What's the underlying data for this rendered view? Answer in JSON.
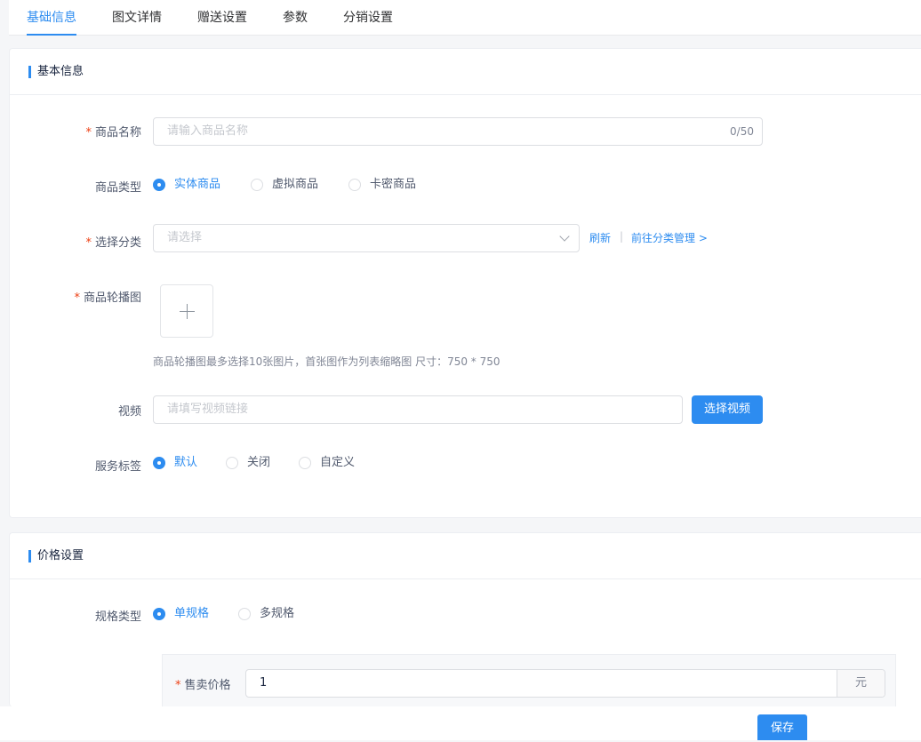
{
  "tabs": [
    {
      "label": "基础信息",
      "active": true
    },
    {
      "label": "图文详情",
      "active": false
    },
    {
      "label": "赠送设置",
      "active": false
    },
    {
      "label": "参数",
      "active": false
    },
    {
      "label": "分销设置",
      "active": false
    }
  ],
  "basic": {
    "title": "基本信息",
    "name_label": "商品名称",
    "name_placeholder": "请输入商品名称",
    "name_count": "0/50",
    "type_label": "商品类型",
    "type_options": [
      "实体商品",
      "虚拟商品",
      "卡密商品"
    ],
    "type_selected": 0,
    "category_label": "选择分类",
    "category_placeholder": "请选择",
    "refresh_label": "刷新",
    "separator": "|",
    "manage_label": "前往分类管理 >",
    "carousel_label": "商品轮播图",
    "carousel_hint": "商品轮播图最多选择10张图片，首张图作为列表缩略图 尺寸：750 * 750",
    "video_label": "视频",
    "video_placeholder": "请填写视频链接",
    "video_button": "选择视频",
    "service_label": "服务标签",
    "service_options": [
      "默认",
      "关闭",
      "自定义"
    ],
    "service_selected": 0
  },
  "price": {
    "title": "价格设置",
    "spec_label": "规格类型",
    "spec_options": [
      "单规格",
      "多规格"
    ],
    "spec_selected": 0,
    "sale_label": "售卖价格",
    "sale_value": "1",
    "sale_unit": "元"
  },
  "footer": {
    "save_label": "保存"
  },
  "colors": {
    "primary": "#2d8cf0",
    "required": "#ed4014"
  }
}
